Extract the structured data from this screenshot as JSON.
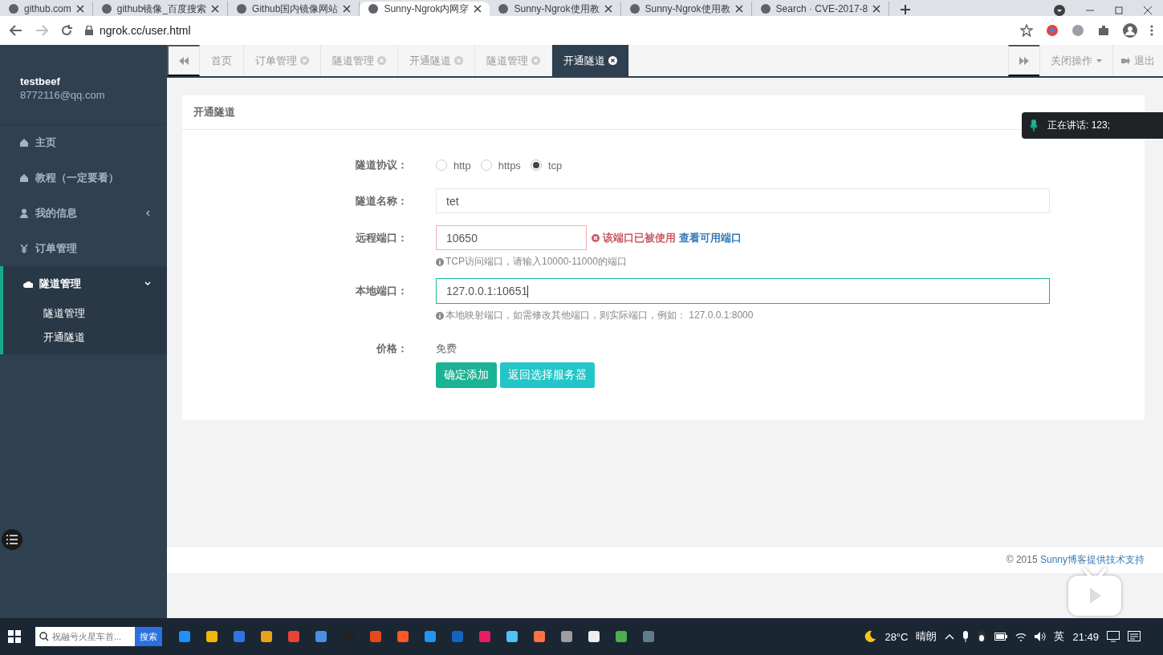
{
  "browser": {
    "tabs": [
      {
        "title": "github.com",
        "selected": false
      },
      {
        "title": "github镜像_百度搜索",
        "selected": false
      },
      {
        "title": "Github国内镜像网站",
        "selected": false
      },
      {
        "title": "Sunny-Ngrok内网穿",
        "selected": true
      },
      {
        "title": "Sunny-Ngrok使用教",
        "selected": false
      },
      {
        "title": "Sunny-Ngrok使用教",
        "selected": false
      },
      {
        "title": "Search · CVE-2017-8",
        "selected": false
      }
    ],
    "address": "ngrok.cc/user.html"
  },
  "sidebar": {
    "user_name": "testbeef",
    "email": "8772116@qq.com",
    "items": [
      {
        "label": "主页",
        "kind": "link",
        "selected": false
      },
      {
        "label": "教程（一定要看）",
        "kind": "link",
        "selected": false
      },
      {
        "label": "我的信息",
        "kind": "group",
        "selected": false,
        "expanded": false
      },
      {
        "label": "订单管理",
        "kind": "link",
        "selected": false
      },
      {
        "label": "隧道管理",
        "kind": "group",
        "selected": true,
        "expanded": true,
        "children": [
          {
            "label": "隧道管理"
          },
          {
            "label": "开通隧道"
          }
        ]
      }
    ]
  },
  "page_tabs": [
    {
      "label": "首页",
      "closable": false,
      "selected": false
    },
    {
      "label": "订单管理",
      "closable": true,
      "selected": false
    },
    {
      "label": "隧道管理",
      "closable": true,
      "selected": false
    },
    {
      "label": "开通隧道",
      "closable": true,
      "selected": false
    },
    {
      "label": "隧道管理",
      "closable": true,
      "selected": false
    },
    {
      "label": "开通隧道",
      "closable": true,
      "selected": true
    }
  ],
  "tab_actions": {
    "close_menu": "关闭操作",
    "logout": "退出"
  },
  "card": {
    "title": "开通隧道",
    "form": {
      "protocol": {
        "label": "隧道协议：",
        "options": [
          {
            "label": "http",
            "selected": false
          },
          {
            "label": "https",
            "selected": false
          },
          {
            "label": "tcp",
            "selected": true
          }
        ]
      },
      "name": {
        "label": "隧道名称：",
        "value": "tet"
      },
      "remote_port": {
        "label": "远程端口：",
        "value": "10650",
        "error": true,
        "error_text": "该端口已被使用",
        "error_link": "查看可用端口",
        "help": "TCP访问端口，请输入10000-11000的端口"
      },
      "local_port": {
        "label": "本地端口：",
        "value": "127.0.0.1:10651",
        "focused": true,
        "help": "本地映射端口，如需修改其他端口，则实际端口，例如： 127.0.0.1:8000"
      },
      "price": {
        "label": "价格：",
        "value": "免费"
      },
      "buttons": [
        {
          "label": "确定添加",
          "kind": "primary"
        },
        {
          "label": "返回选择服务器",
          "kind": "info"
        }
      ]
    }
  },
  "footer": {
    "copyright": "© 2015 ",
    "link": "Sunny博客提供技术支持"
  },
  "voice_toast": {
    "text": "正在讲话: 123;"
  },
  "taskbar": {
    "search_placeholder": "祝融号火星车首...",
    "search_button": "搜索",
    "temperature": "28°C",
    "weather": "晴朗",
    "input_method": "英",
    "time": "21:49"
  }
}
